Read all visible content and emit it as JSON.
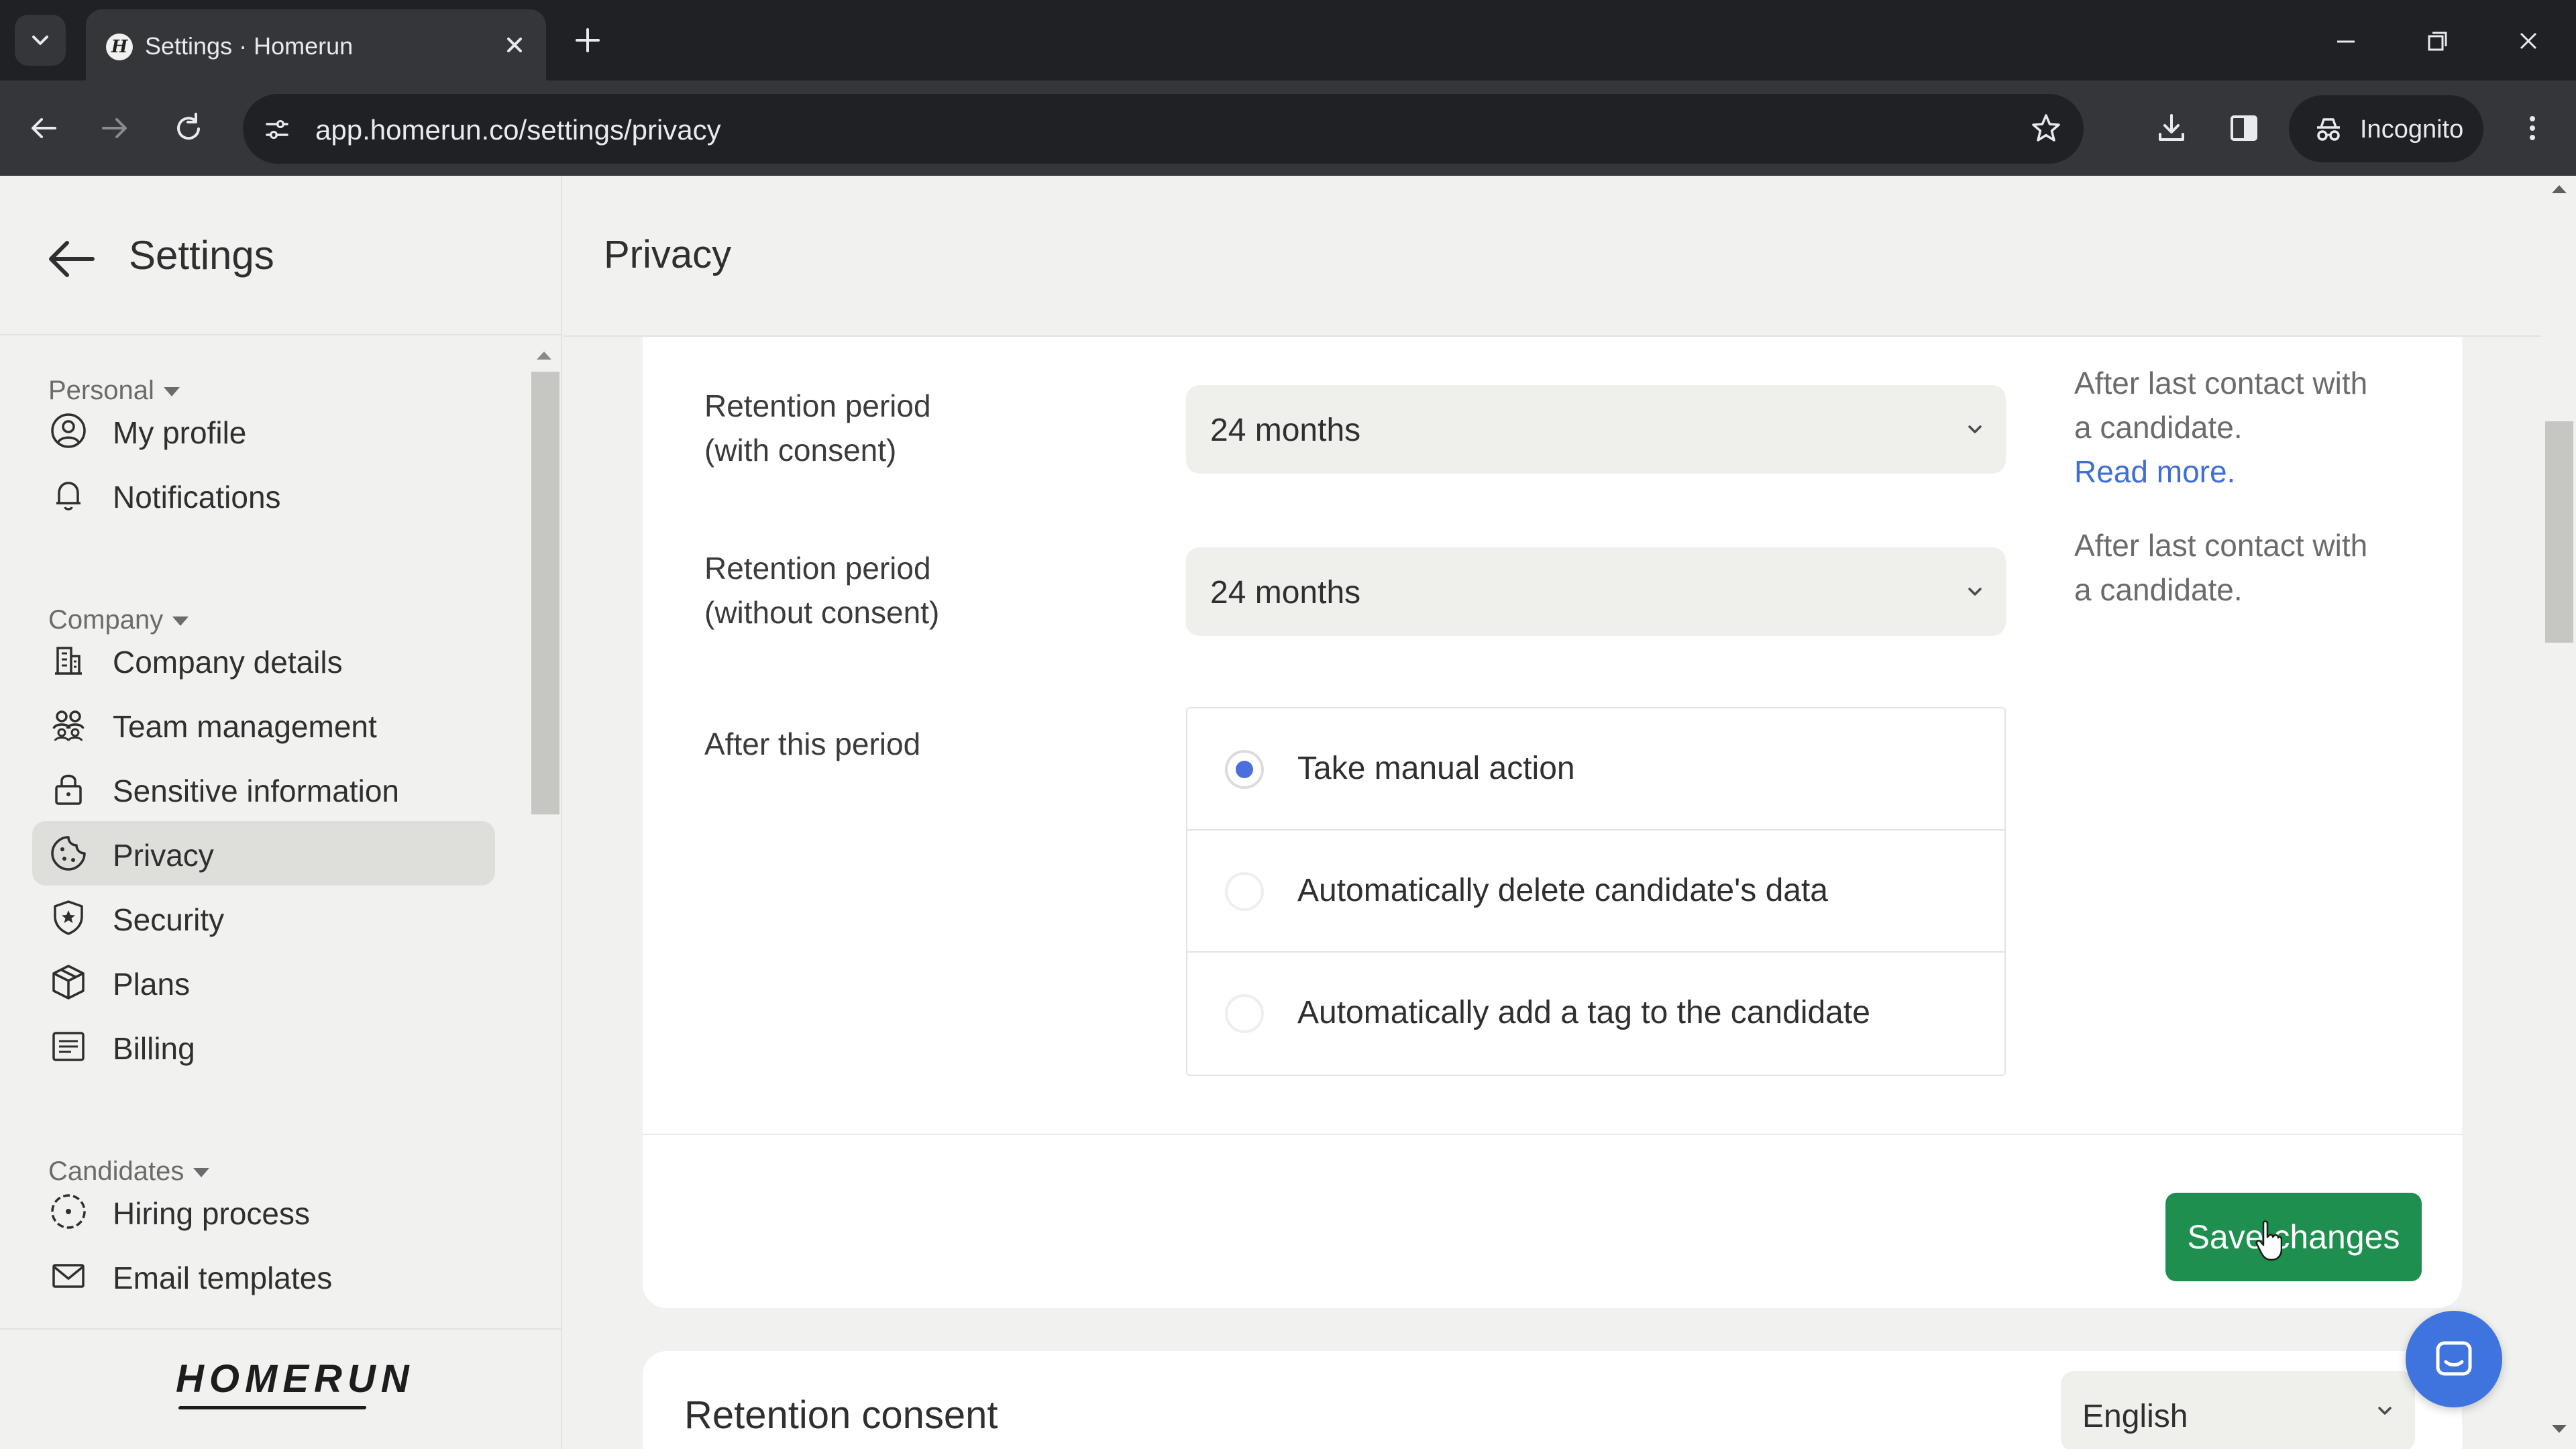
{
  "browser": {
    "tab_title": "Settings · Homerun",
    "url": "app.homerun.co/settings/privacy",
    "incognito_label": "Incognito"
  },
  "sidebar": {
    "title": "Settings",
    "groups": [
      {
        "label": "Personal",
        "items": [
          {
            "label": "My profile",
            "icon": "user-circle-icon"
          },
          {
            "label": "Notifications",
            "icon": "bell-icon"
          }
        ]
      },
      {
        "label": "Company",
        "items": [
          {
            "label": "Company details",
            "icon": "building-icon"
          },
          {
            "label": "Team management",
            "icon": "team-icon"
          },
          {
            "label": "Sensitive information",
            "icon": "lock-icon"
          },
          {
            "label": "Privacy",
            "icon": "cookie-icon",
            "active": true
          },
          {
            "label": "Security",
            "icon": "shield-star-icon"
          },
          {
            "label": "Plans",
            "icon": "box-icon"
          },
          {
            "label": "Billing",
            "icon": "receipt-icon"
          }
        ]
      },
      {
        "label": "Candidates",
        "items": [
          {
            "label": "Hiring process",
            "icon": "process-circle-icon"
          },
          {
            "label": "Email templates",
            "icon": "mail-icon"
          }
        ]
      }
    ],
    "logo_text": "HOMERUN"
  },
  "main": {
    "title": "Privacy",
    "retention_with_consent": {
      "label_line1": "Retention period",
      "label_line2": "(with consent)",
      "value": "24 months",
      "hint_line1": "After last contact with",
      "hint_line2": "a candidate.",
      "hint_link": "Read more."
    },
    "retention_without_consent": {
      "label_line1": "Retention period",
      "label_line2": "(without consent)",
      "value": "24 months",
      "hint_line1": "After last contact with",
      "hint_line2": "a candidate."
    },
    "after_period": {
      "label": "After this period",
      "options": [
        {
          "label": "Take manual action",
          "selected": true
        },
        {
          "label": "Automatically delete candidate's data",
          "selected": false
        },
        {
          "label": "Automatically add a tag to the candidate",
          "selected": false
        }
      ]
    },
    "save_label": "Save changes",
    "retention_consent": {
      "title": "Retention consent",
      "language": "English"
    }
  },
  "colors": {
    "accent_green": "#1f8f4f",
    "radio_blue": "#4c6fe0",
    "link_blue": "#3f6ed8",
    "chat_blue": "#3f74de",
    "sidebar_active": "#dededb"
  }
}
